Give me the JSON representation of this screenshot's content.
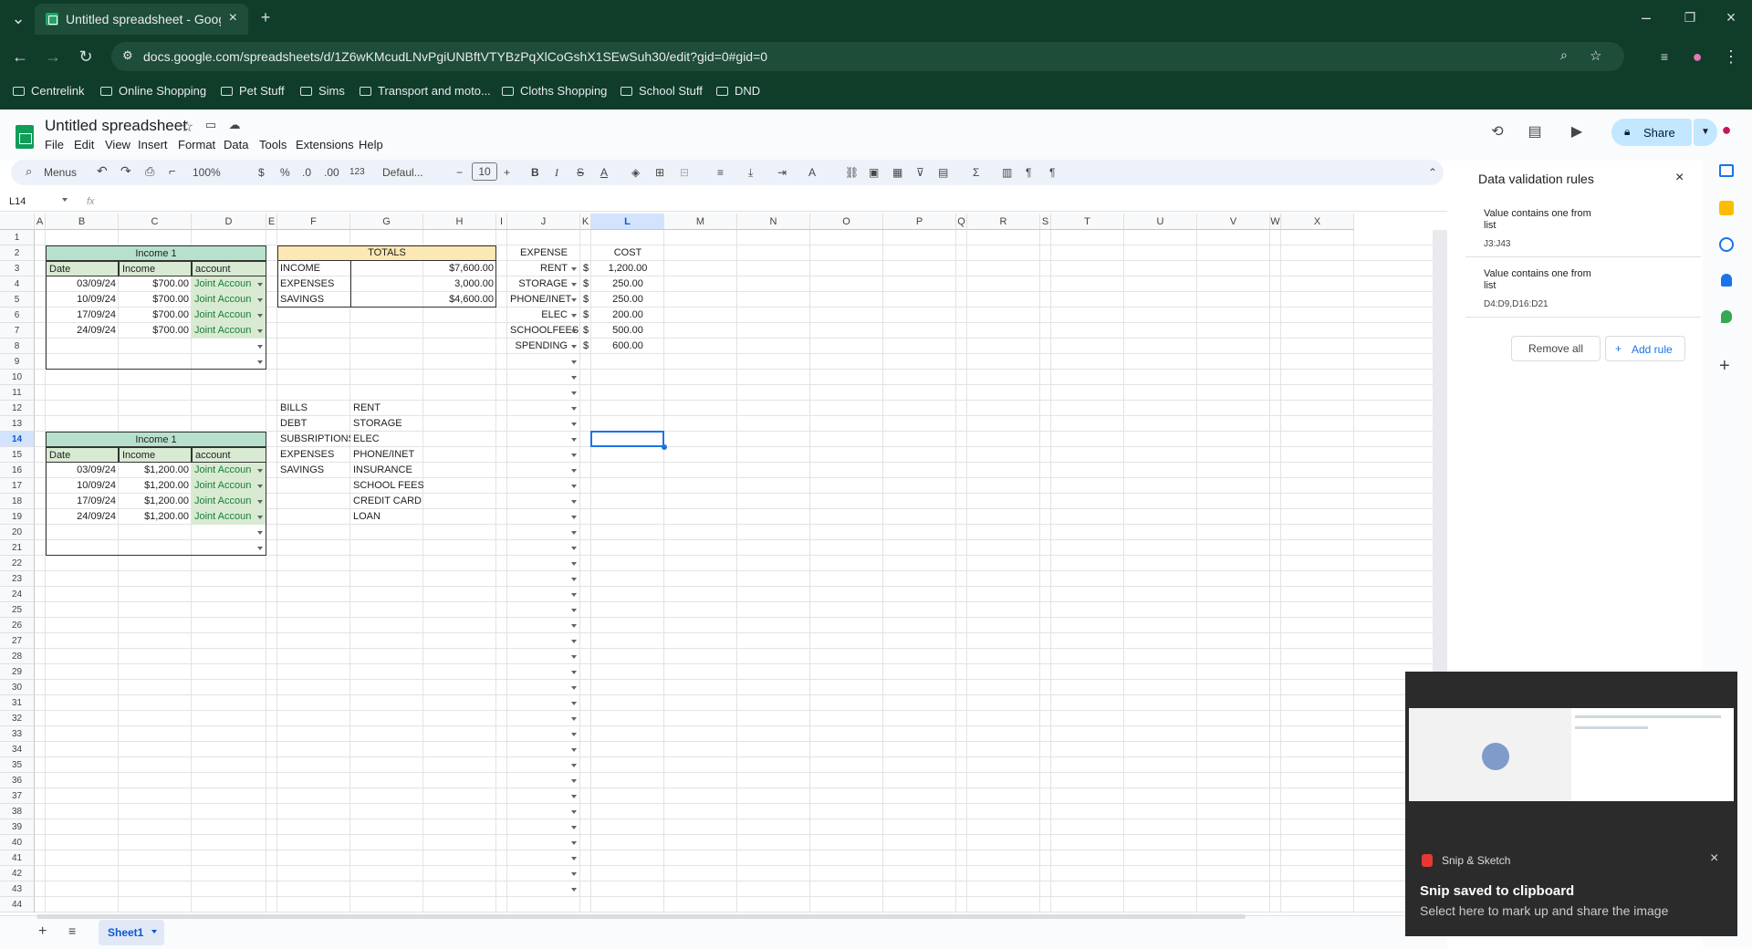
{
  "browser": {
    "tab_title": "Untitled spreadsheet - Google S",
    "url": "docs.google.com/spreadsheets/d/1Z6wKMcudLNvPgiUNBftVTYBzPqXlCoGshX1SEwSuh30/edit?gid=0#gid=0",
    "bookmarks": [
      "Centrelink",
      "Online Shopping",
      "Pet Stuff",
      "Sims",
      "Transport and moto...",
      "Cloths Shopping",
      "School Stuff",
      "DND"
    ]
  },
  "doc": {
    "title": "Untitled spreadsheet",
    "menus": [
      "File",
      "Edit",
      "View",
      "Insert",
      "Format",
      "Data",
      "Tools",
      "Extensions",
      "Help"
    ],
    "share_label": "Share"
  },
  "toolbar": {
    "search": "Menus",
    "zoom": "100%",
    "currency": "$",
    "percent": "%",
    "dec_less": ".0",
    "dec_more": ".00",
    "num_format": "123",
    "font": "Defaul...",
    "font_size": "10",
    "bold": "B",
    "italic": "I"
  },
  "formula_bar": {
    "cell_ref": "L14",
    "fx": "fx"
  },
  "columns": [
    "A",
    "B",
    "C",
    "D",
    "E",
    "F",
    "G",
    "H",
    "I",
    "J",
    "K",
    "L",
    "M",
    "N",
    "O",
    "P",
    "Q",
    "R",
    "S",
    "T",
    "U",
    "V",
    "W",
    "X"
  ],
  "income1": {
    "title": "Income 1",
    "headers": [
      "Date",
      "Income",
      "account"
    ],
    "rows": [
      [
        "03/09/24",
        "$700.00",
        "Joint Accoun"
      ],
      [
        "10/09/24",
        "$700.00",
        "Joint Accoun"
      ],
      [
        "17/09/24",
        "$700.00",
        "Joint Accoun"
      ],
      [
        "24/09/24",
        "$700.00",
        "Joint Accoun"
      ]
    ]
  },
  "income2": {
    "title": "Income 1",
    "headers": [
      "Date",
      "Income",
      "account"
    ],
    "rows": [
      [
        "03/09/24",
        "$1,200.00",
        "Joint Accoun"
      ],
      [
        "10/09/24",
        "$1,200.00",
        "Joint Accoun"
      ],
      [
        "17/09/24",
        "$1,200.00",
        "Joint Accoun"
      ],
      [
        "24/09/24",
        "$1,200.00",
        "Joint Accoun"
      ]
    ]
  },
  "totals": {
    "title": "TOTALS",
    "rows": [
      [
        "INCOME",
        "$7,600.00"
      ],
      [
        "EXPENSES",
        "3,000.00"
      ],
      [
        "SAVINGS",
        "$4,600.00"
      ]
    ]
  },
  "expenses": {
    "header_expense": "EXPENSE",
    "header_cost": "COST",
    "currency": "$",
    "rows": [
      [
        "RENT",
        "1,200.00"
      ],
      [
        "STORAGE",
        "250.00"
      ],
      [
        "PHONE/INET",
        "250.00"
      ],
      [
        "ELEC",
        "200.00"
      ],
      [
        "SCHOOLFEES",
        "500.00"
      ],
      [
        "SPENDING",
        "600.00"
      ]
    ]
  },
  "categories": [
    "BILLS",
    "DEBT",
    "SUBSRIPTIONS",
    "EXPENSES",
    "SAVINGS"
  ],
  "expense_list": [
    "RENT",
    "STORAGE",
    "ELEC",
    "PHONE/INET",
    "INSURANCE",
    "SCHOOL FEES",
    "CREDIT CARD",
    "LOAN"
  ],
  "panel": {
    "title": "Data validation rules",
    "rules": [
      {
        "desc": "Value contains one from list",
        "range": "J3:J43"
      },
      {
        "desc": "Value contains one from list",
        "range": "D4:D9,D16:D21"
      }
    ],
    "remove_all": "Remove all",
    "add_rule": "Add rule"
  },
  "sheet_tab": "Sheet1",
  "toast": {
    "app": "Snip & Sketch",
    "title": "Snip saved to clipboard",
    "body": "Select here to mark up and share the image"
  }
}
